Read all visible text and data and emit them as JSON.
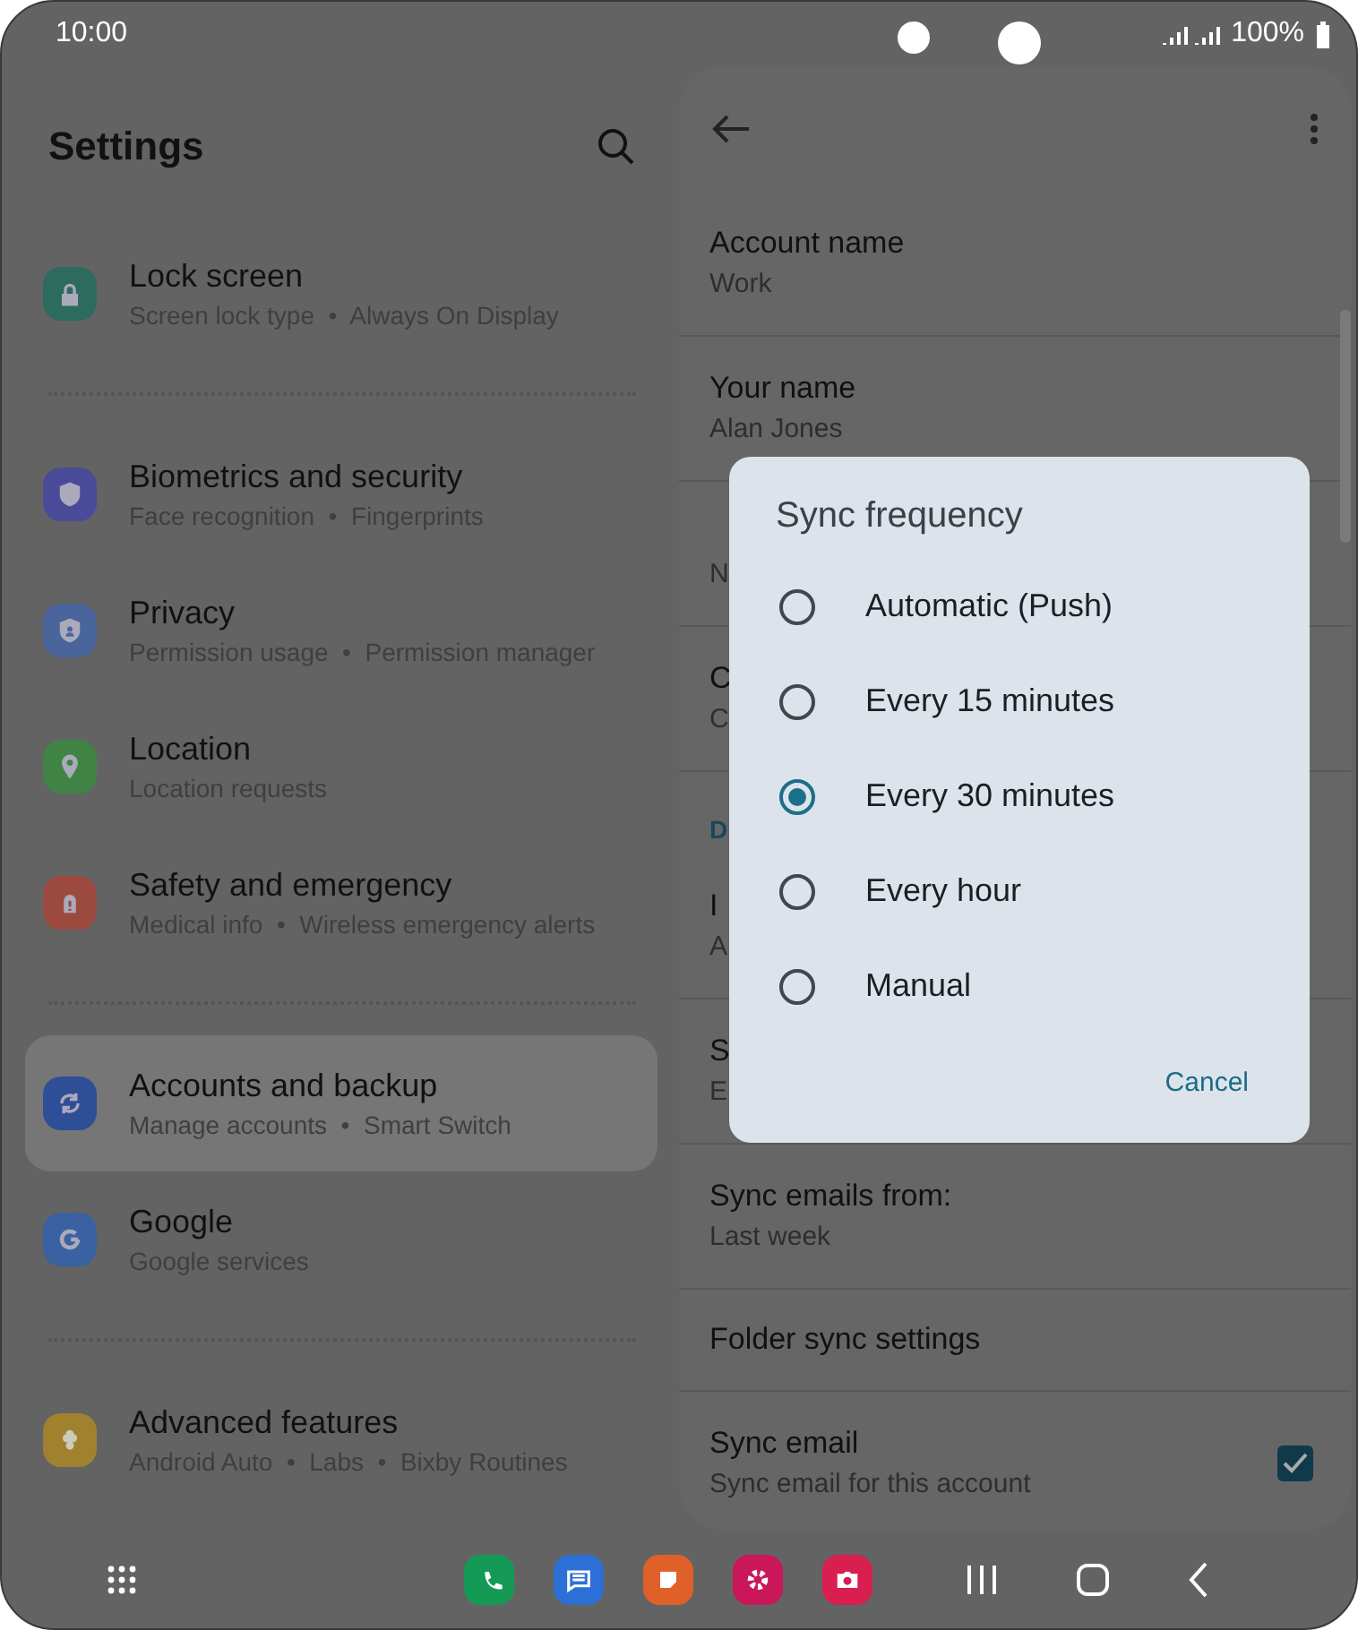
{
  "status_bar": {
    "time": "10:00",
    "battery": "100%"
  },
  "settings": {
    "title": "Settings",
    "groups": [
      [
        {
          "title": "Lock screen",
          "subtitle": "Screen lock type  •  Always On Display",
          "color": "#2d6b5f",
          "selected": false
        }
      ],
      [
        {
          "title": "Biometrics and security",
          "subtitle": "Face recognition  •  Fingerprints",
          "color": "#4a4b98",
          "selected": false
        },
        {
          "title": "Privacy",
          "subtitle": "Permission usage  •  Permission manager",
          "color": "#4a649c",
          "selected": false
        },
        {
          "title": "Location",
          "subtitle": "Location requests",
          "color": "#3f8444",
          "selected": false
        },
        {
          "title": "Safety and emergency",
          "subtitle": "Medical info  •  Wireless emergency alerts",
          "color": "#9c4a40",
          "selected": false
        }
      ],
      [
        {
          "title": "Accounts and backup",
          "subtitle": "Manage accounts  •  Smart Switch",
          "color": "#2f4e98",
          "selected": true
        },
        {
          "title": "Google",
          "subtitle": "Google services",
          "color": "#3a62a2",
          "selected": false
        }
      ],
      [
        {
          "title": "Advanced features",
          "subtitle": "Android Auto  •  Labs  •  Bixby Routines",
          "color": "#a0822e",
          "selected": false
        }
      ]
    ]
  },
  "account": {
    "rows": [
      {
        "kind": "row",
        "title": "Account name",
        "value": "Work"
      },
      {
        "kind": "row",
        "title": "Your name",
        "value": "Alan Jones"
      },
      {
        "kind": "row",
        "value": "N"
      },
      {
        "kind": "row",
        "title": "C",
        "value": "C"
      },
      {
        "kind": "header",
        "title": "D"
      },
      {
        "kind": "row",
        "title": "I",
        "value": "A"
      },
      {
        "kind": "row",
        "title": "S",
        "value": "E"
      },
      {
        "kind": "row",
        "title": "Sync emails from:",
        "value": "Last week"
      },
      {
        "kind": "row",
        "title": "Folder sync settings"
      },
      {
        "kind": "checkbox",
        "title": "Sync email",
        "value": "Sync email for this account",
        "checked": true
      }
    ]
  },
  "dialog": {
    "title": "Sync frequency",
    "options": [
      {
        "label": "Automatic (Push)",
        "selected": false
      },
      {
        "label": "Every 15 minutes",
        "selected": false
      },
      {
        "label": "Every 30 minutes",
        "selected": true
      },
      {
        "label": "Every hour",
        "selected": false
      },
      {
        "label": "Manual",
        "selected": false
      }
    ],
    "cancel": "Cancel"
  },
  "dock": [
    {
      "color": "#159a55"
    },
    {
      "color": "#2c6fd6"
    },
    {
      "color": "#e0602a"
    },
    {
      "color": "#c9175a"
    },
    {
      "color": "#d91e50"
    }
  ]
}
